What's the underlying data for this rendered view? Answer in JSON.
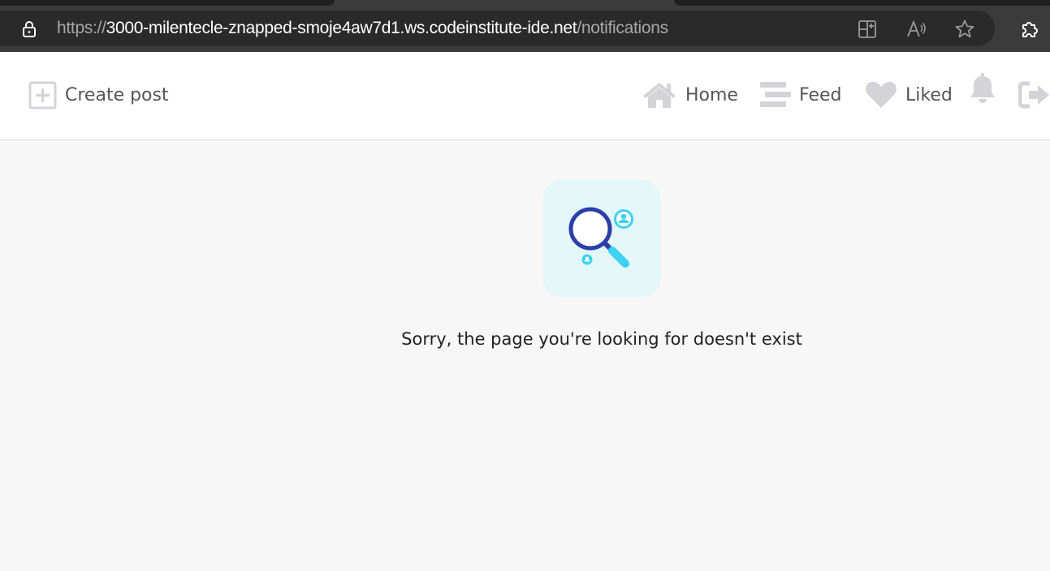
{
  "browser": {
    "url_scheme": "https://",
    "url_host": "3000-milentecle-znapped-smoje4aw7d1.ws.codeinstitute-ide.net",
    "url_path": "/notifications"
  },
  "navbar": {
    "create_post_label": "Create post",
    "home_label": "Home",
    "feed_label": "Feed",
    "liked_label": "Liked"
  },
  "main": {
    "message": "Sorry, the page you're looking for doesn't exist"
  },
  "icons": {
    "lock": "lock-icon",
    "split_screen": "split-screen-icon",
    "read_aloud": "read-aloud-icon",
    "favorite": "star-icon",
    "extensions": "puzzle-icon",
    "create_post": "plus-square-icon",
    "home": "home-icon",
    "feed": "stream-icon",
    "liked": "heart-icon",
    "notifications": "bell-icon",
    "sign_out": "sign-out-icon"
  },
  "colors": {
    "nav_icon": "#d3d3d8",
    "nav_text": "#555555",
    "page_bg": "#f7f7f7",
    "art_bg": "#e3f6f8",
    "art_accent": "#2c3ea8",
    "art_cyan": "#3ed2f0"
  }
}
